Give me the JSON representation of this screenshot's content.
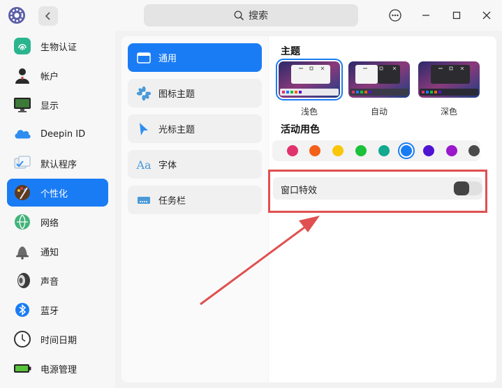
{
  "titlebar": {
    "search_label": "搜索"
  },
  "sidebar": {
    "items": [
      {
        "label": "生物认证",
        "icon": "fingerprint-icon"
      },
      {
        "label": "帐户",
        "icon": "account-icon"
      },
      {
        "label": "显示",
        "icon": "display-icon"
      },
      {
        "label": "Deepin ID",
        "icon": "cloud-icon"
      },
      {
        "label": "默认程序",
        "icon": "default-apps-icon"
      },
      {
        "label": "个性化",
        "icon": "palette-icon",
        "active": true
      },
      {
        "label": "网络",
        "icon": "network-icon"
      },
      {
        "label": "通知",
        "icon": "bell-icon"
      },
      {
        "label": "声音",
        "icon": "speaker-icon"
      },
      {
        "label": "蓝牙",
        "icon": "bluetooth-icon"
      },
      {
        "label": "时间日期",
        "icon": "clock-icon"
      },
      {
        "label": "电源管理",
        "icon": "battery-icon"
      }
    ]
  },
  "submenu": {
    "items": [
      {
        "label": "通用",
        "icon": "general-icon",
        "active": true
      },
      {
        "label": "图标主题",
        "icon": "icon-theme-icon"
      },
      {
        "label": "光标主题",
        "icon": "cursor-icon"
      },
      {
        "label": "字体",
        "icon": "font-icon",
        "glyph": "Aa"
      },
      {
        "label": "任务栏",
        "icon": "taskbar-icon"
      }
    ]
  },
  "content": {
    "theme_title": "主题",
    "themes": [
      {
        "label": "浅色",
        "selected": true
      },
      {
        "label": "自动"
      },
      {
        "label": "深色"
      }
    ],
    "accent_title": "活动用色",
    "accent_colors": [
      "#e0336e",
      "#f36017",
      "#f9c60a",
      "#1bc13b",
      "#12a98e",
      "#1a7cf4",
      "#5013d2",
      "#9b18cc",
      "#4a4a4a"
    ],
    "selected_accent_index": 5,
    "window_effect_label": "窗口特效",
    "window_effect_enabled": false
  },
  "colors": {
    "accent": "#1a7cf4",
    "annotation": "#e05050"
  }
}
